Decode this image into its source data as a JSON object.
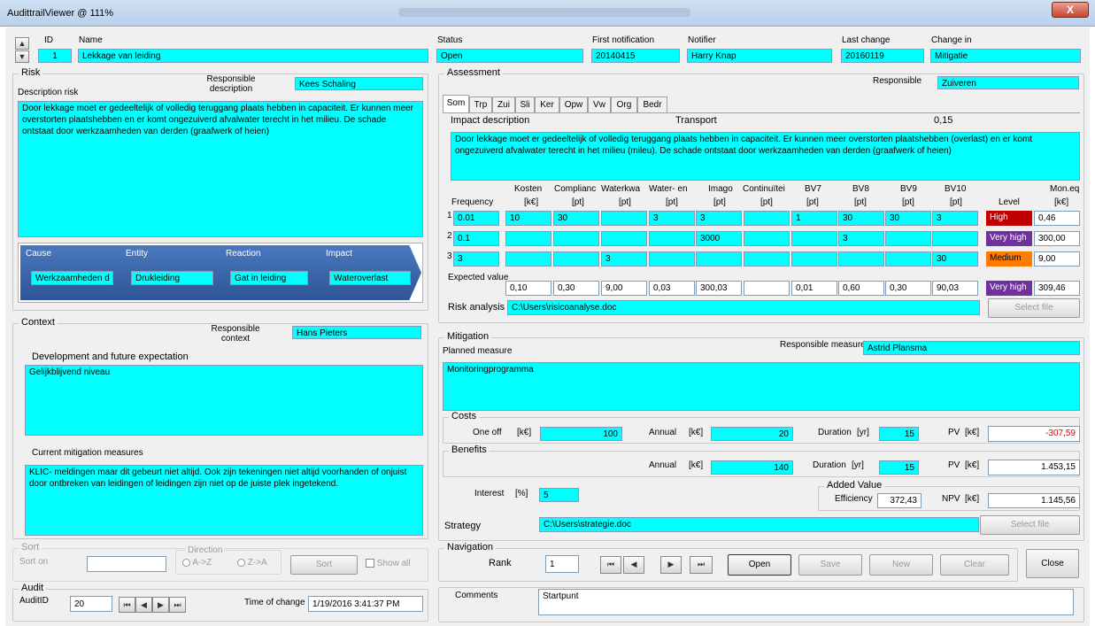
{
  "window": {
    "title": "AudittrailViewer @ 111%",
    "close_glyph": "X"
  },
  "header": {
    "id_label": "ID",
    "id_value": "1",
    "name_label": "Name",
    "name_value": "Lekkage van leiding",
    "status_label": "Status",
    "status_value": "Open",
    "first_label": "First notification",
    "first_value": "20140415",
    "notifier_label": "Notifier",
    "notifier_value": "Harry Knap",
    "lastchange_label": "Last change",
    "lastchange_value": "20160119",
    "changein_label": "Change in",
    "changein_value": "Mitigatie",
    "spin_up": "▲",
    "spin_down": "▼"
  },
  "risk": {
    "legend": "Risk",
    "responsible_label": "Responsible description",
    "responsible_value": "Kees Schaling",
    "desc_label": "Description risk",
    "desc_value": "Door lekkage moet er gedeeltelijk of volledig teruggang plaats hebben in capaciteit. Er kunnen meer overstorten plaatshebben en er komt ongezuiverd afvalwater terecht in het milieu. De schade ontstaat door werkzaamheden van derden (graafwerk of heien)",
    "chain": [
      {
        "label": "Cause",
        "value": "Werkzaamheden d"
      },
      {
        "label": "Entity",
        "value": "Drukleiding"
      },
      {
        "label": "Reaction",
        "value": "Gat in leiding"
      },
      {
        "label": "Impact",
        "value": "Wateroverlast"
      }
    ]
  },
  "context": {
    "legend": "Context",
    "responsible_label": "Responsible context",
    "responsible_value": "Hans Pieters",
    "dev_label": "Development and future expectation",
    "dev_value": "Gelijkblijvend niveau",
    "current_label": "Current mitigation measures",
    "current_value": "KLIC- meldingen maar dit gebeurt niet altijd. Ook zijn tekeningen niet altijd voorhanden of onjuist door ontbreken van leidingen of leidingen zijn niet op de juiste plek ingetekend."
  },
  "sort": {
    "legend": "Sort",
    "sort_on_label": "Sort on",
    "sort_on_value": "",
    "direction_legend": "Direction",
    "opt_az": "A->Z",
    "opt_za": "Z->A",
    "sort_button": "Sort",
    "show_all": "Show all"
  },
  "audit": {
    "legend": "Audit",
    "auditid_label": "AuditID",
    "auditid_value": "20",
    "time_label": "Time of change",
    "time_value": "1/19/2016 3:41:37 PM",
    "nav": [
      "⏮",
      "◀",
      "▶",
      "⏭"
    ]
  },
  "assessment": {
    "legend": "Assessment",
    "responsible_label": "Responsible",
    "responsible_value": "Zuiveren",
    "tabs": [
      "Som",
      "Trp",
      "Zui",
      "Sli",
      "Ker",
      "Opw",
      "Vw",
      "Org",
      "Bedr"
    ],
    "impact_label": "Impact description",
    "impact_category": "Transport",
    "impact_weight": "0,15",
    "impact_value": "Door lekkage moet er gedeeltelijk of volledig teruggang plaats hebben in capaciteit. Er kunnen meer overstorten plaatshebben (overlast) en er komt ongezuiverd afvalwater terecht in het milieu (mileu). De schade ontstaat door werkzaamheden van derden (graafwerk of heien)",
    "columns": [
      {
        "name": "Frequency",
        "unit": ""
      },
      {
        "name": "Kosten",
        "unit": "[k€]"
      },
      {
        "name": "Complianc",
        "unit": "[pt]"
      },
      {
        "name": "Waterkwa",
        "unit": "[pt]"
      },
      {
        "name": "Water- en",
        "unit": "[pt]"
      },
      {
        "name": "Imago",
        "unit": "[pt]"
      },
      {
        "name": "Continuïtei",
        "unit": "[pt]"
      },
      {
        "name": "BV7",
        "unit": "[pt]"
      },
      {
        "name": "BV8",
        "unit": "[pt]"
      },
      {
        "name": "BV9",
        "unit": "[pt]"
      },
      {
        "name": "BV10",
        "unit": "[pt]"
      }
    ],
    "level_label": "Level",
    "moneq_label": "Mon.eq",
    "moneq_unit": "[k€]",
    "rows": [
      {
        "n": "1",
        "cells": [
          "0.01",
          "10",
          "30",
          "",
          "3",
          "3",
          "",
          "1",
          "30",
          "30",
          "3"
        ],
        "level": "High",
        "level_color": "#c00000",
        "moneq": "0,46"
      },
      {
        "n": "2",
        "cells": [
          "0.1",
          "",
          "",
          "",
          "",
          "3000",
          "",
          "",
          "3",
          "",
          ""
        ],
        "level": "Very high",
        "level_color": "#7030a0",
        "moneq": "300,00"
      },
      {
        "n": "3",
        "cells": [
          "3",
          "",
          "",
          "3",
          "",
          "",
          "",
          "",
          "",
          "",
          "30"
        ],
        "level": "Medium",
        "level_color": "#ff7c00",
        "moneq": "9,00"
      }
    ],
    "expected_label": "Expected value",
    "expected": [
      "0,10",
      "0,30",
      "9,00",
      "0,03",
      "300,03",
      "",
      "0,01",
      "0,60",
      "0,30",
      "90,03"
    ],
    "expected_level": "Very high",
    "expected_level_color": "#7030a0",
    "expected_moneq": "309,46",
    "risk_analysis_label": "Risk analysis",
    "risk_analysis_value": "C:\\Users\\risicoanalyse.doc",
    "select_file": "Select file"
  },
  "mitigation": {
    "legend": "Mitigation",
    "planned_label": "Planned measure",
    "responsible_label": "Responsible measure",
    "responsible_value": "Astrid Plansma",
    "planned_value": "Monitoringprogramma",
    "costs_legend": "Costs",
    "oneoff_label": "One off",
    "oneoff_unit": "[k€]",
    "oneoff_value": "100",
    "annual_label": "Annual",
    "annual_unit": "[k€]",
    "costs_annual_value": "20",
    "duration_label": "Duration",
    "duration_unit": "[yr]",
    "costs_duration_value": "15",
    "pv_label": "PV",
    "pv_unit": "[k€]",
    "costs_pv_value": "-307,59",
    "benefits_legend": "Benefits",
    "benefits_annual_value": "140",
    "benefits_duration_value": "15",
    "benefits_pv_value": "1.453,15",
    "interest_label": "Interest",
    "interest_unit": "[%]",
    "interest_value": "5",
    "added_value_legend": "Added Value",
    "efficiency_label": "Efficiency",
    "efficiency_value": "372,43",
    "npv_label": "NPV",
    "npv_unit": "[k€]",
    "npv_value": "1.145,56",
    "strategy_label": "Strategy",
    "strategy_value": "C:\\Users\\strategie.doc",
    "select_file": "Select file"
  },
  "navigation": {
    "legend": "Navigation",
    "rank_label": "Rank",
    "rank_value": "1",
    "nav": [
      "⏮",
      "◀",
      "▶",
      "⏭"
    ],
    "open": "Open",
    "save": "Save",
    "new": "New",
    "clear": "Clear",
    "close": "Close"
  },
  "comments": {
    "label": "Comments",
    "value": "Startpunt"
  }
}
